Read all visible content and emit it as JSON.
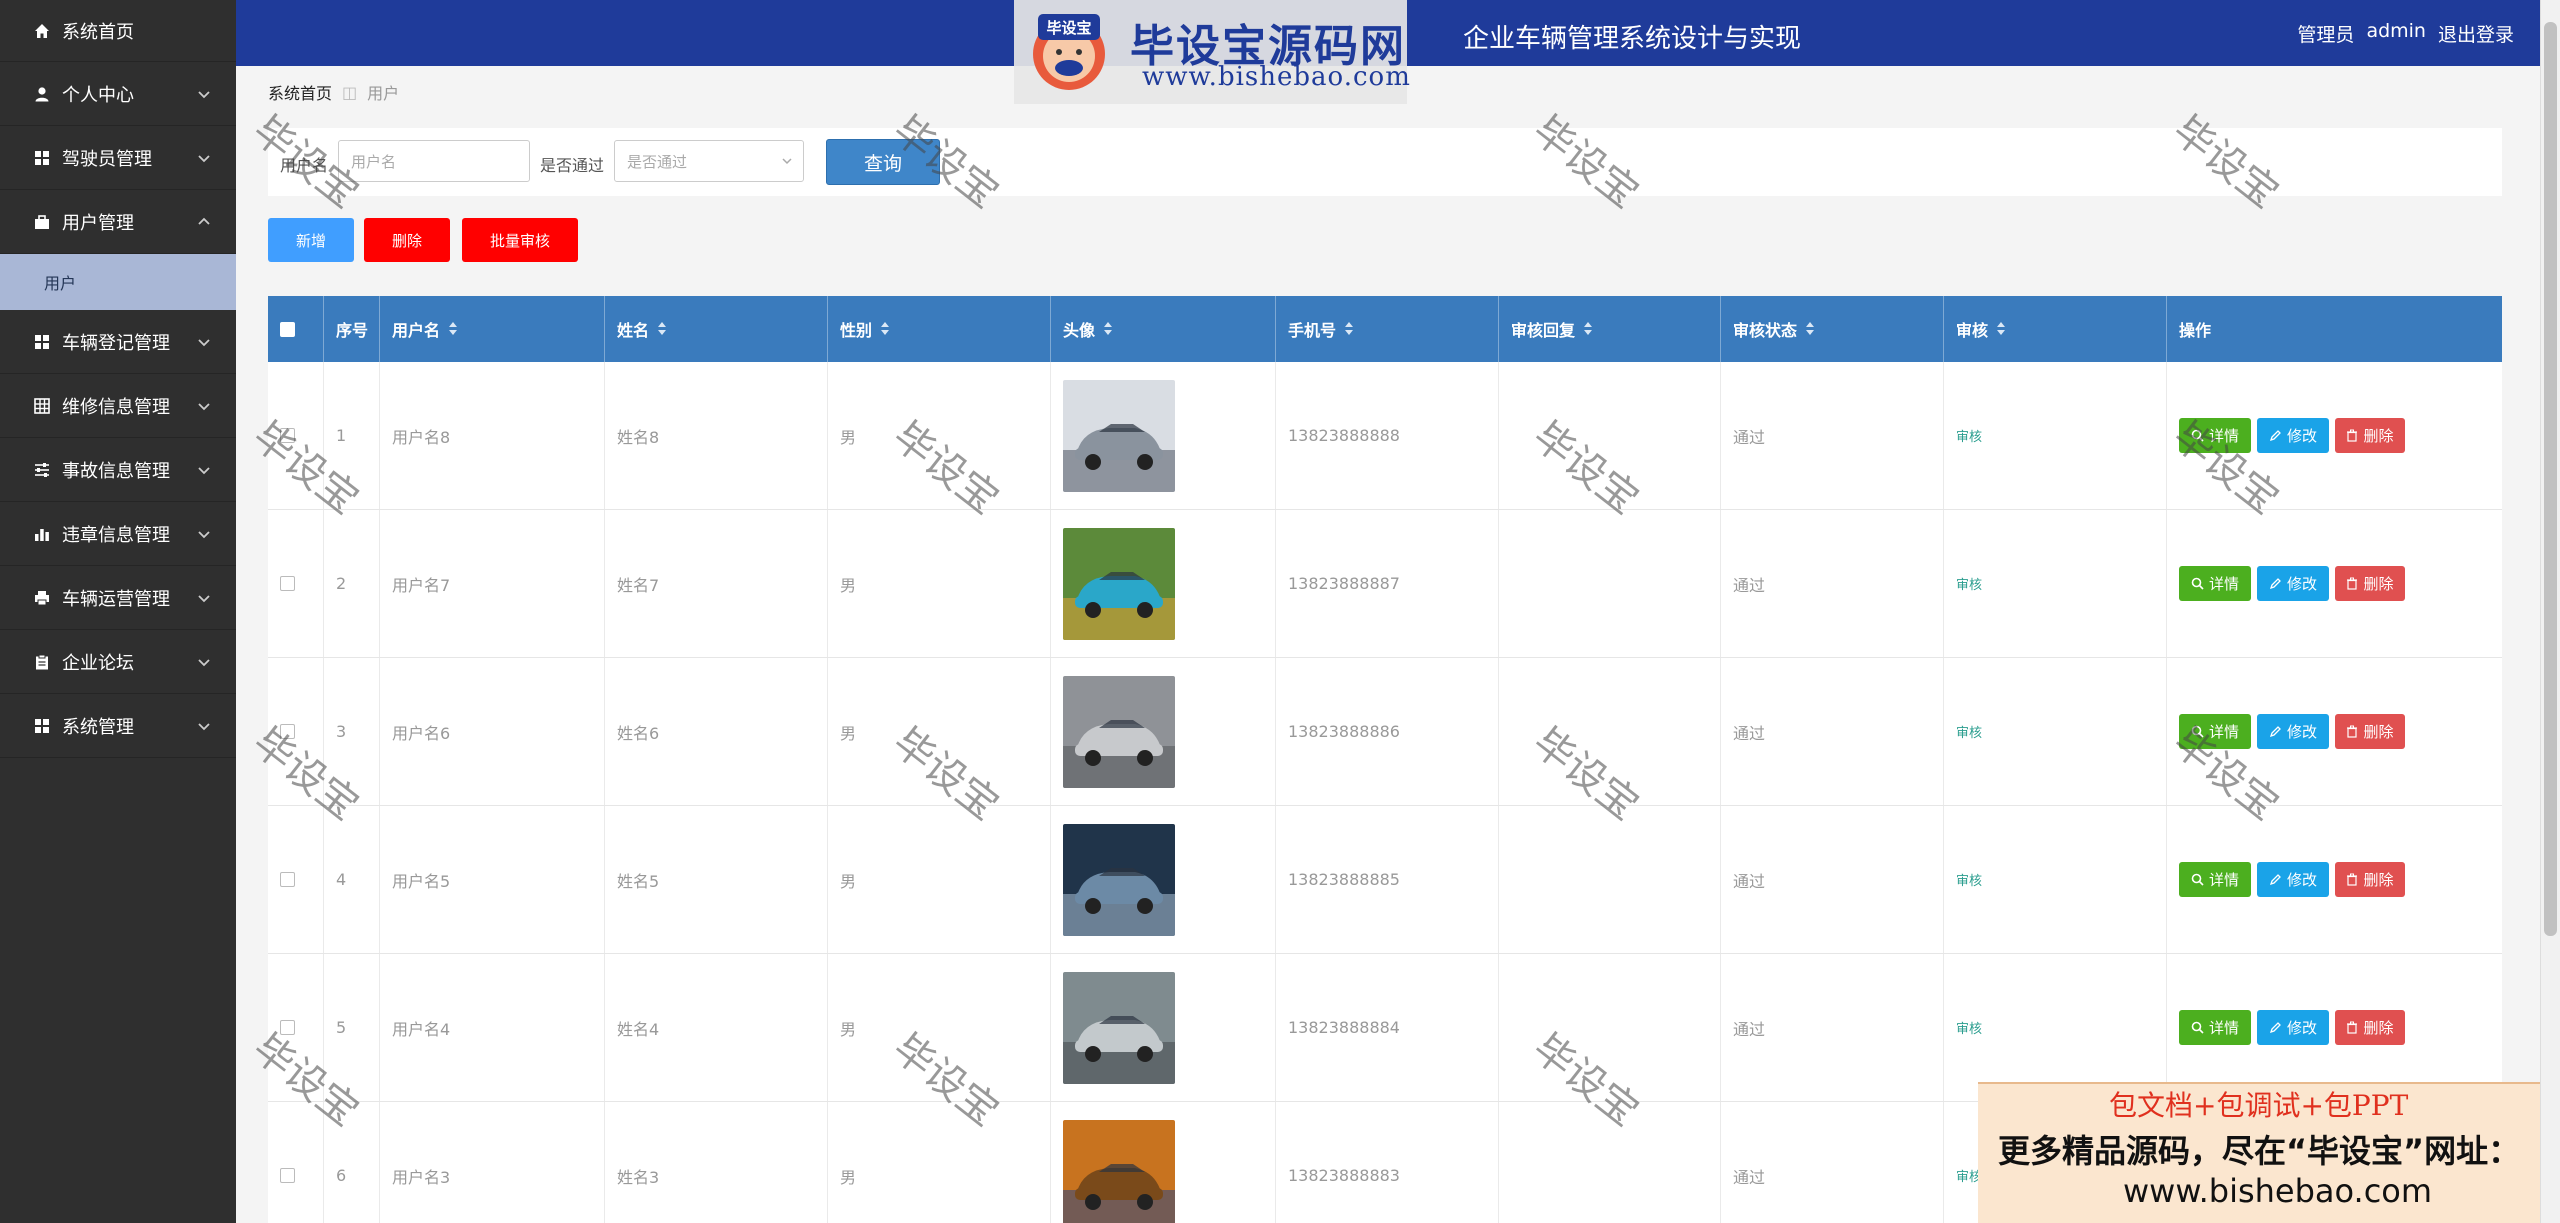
{
  "header": {
    "title": "企业车辆管理系统设计与实现",
    "role": "管理员",
    "username": "admin",
    "logout": "退出登录"
  },
  "brand": {
    "name": "毕设宝源码网",
    "url": "www.bishebao.com"
  },
  "sidebar": {
    "items": [
      {
        "label": "系统首页",
        "icon": "home-icon"
      },
      {
        "label": "个人中心",
        "icon": "user-icon"
      },
      {
        "label": "驾驶员管理",
        "icon": "grid-icon"
      },
      {
        "label": "用户管理",
        "icon": "briefcase-icon"
      },
      {
        "label": "车辆登记管理",
        "icon": "grid-icon"
      },
      {
        "label": "维修信息管理",
        "icon": "table-icon"
      },
      {
        "label": "事故信息管理",
        "icon": "sliders-icon"
      },
      {
        "label": "违章信息管理",
        "icon": "bar-chart-icon"
      },
      {
        "label": "车辆运营管理",
        "icon": "printer-icon"
      },
      {
        "label": "企业论坛",
        "icon": "clipboard-icon"
      },
      {
        "label": "系统管理",
        "icon": "grid-icon"
      }
    ],
    "sub_item": "用户"
  },
  "breadcrumb": {
    "home": "系统首页",
    "current": "用户"
  },
  "search": {
    "username_label": "用户名",
    "username_placeholder": "用户名",
    "pass_label": "是否通过",
    "pass_placeholder": "是否通过",
    "query_button": "查询"
  },
  "actions": {
    "add": "新增",
    "delete": "删除",
    "batch_review": "批量审核"
  },
  "table": {
    "columns": [
      "序号",
      "用户名",
      "姓名",
      "性别",
      "头像",
      "手机号",
      "审核回复",
      "审核状态",
      "审核",
      "操作"
    ],
    "rows": [
      {
        "no": "1",
        "username": "用户名8",
        "name": "姓名8",
        "gender": "男",
        "phone": "13823888888",
        "reply": "",
        "status": "通过",
        "review": "审核"
      },
      {
        "no": "2",
        "username": "用户名7",
        "name": "姓名7",
        "gender": "男",
        "phone": "13823888887",
        "reply": "",
        "status": "通过",
        "review": "审核"
      },
      {
        "no": "3",
        "username": "用户名6",
        "name": "姓名6",
        "gender": "男",
        "phone": "13823888886",
        "reply": "",
        "status": "通过",
        "review": "审核"
      },
      {
        "no": "4",
        "username": "用户名5",
        "name": "姓名5",
        "gender": "男",
        "phone": "13823888885",
        "reply": "",
        "status": "通过",
        "review": "审核"
      },
      {
        "no": "5",
        "username": "用户名4",
        "name": "姓名4",
        "gender": "男",
        "phone": "13823888884",
        "reply": "",
        "status": "通过",
        "review": "审核"
      },
      {
        "no": "6",
        "username": "用户名3",
        "name": "姓名3",
        "gender": "男",
        "phone": "13823888883",
        "reply": "",
        "status": "通过",
        "review": "审核"
      }
    ],
    "op_labels": {
      "detail": "详情",
      "edit": "修改",
      "delete": "删除"
    }
  },
  "watermark": "毕设宝",
  "promo": {
    "line1": "包文档+包调试+包PPT",
    "line2": "更多精品源码，尽在“毕设宝”网址：",
    "line3": "www.bishebao.com"
  },
  "colors": {
    "sidebar_bg": "#2f2f2f",
    "header_bg": "#1f3b9a",
    "table_head": "#3a7bbd",
    "btn_add": "#409eff",
    "btn_red": "#ff0000",
    "detail": "#4caf1f",
    "edit": "#1aa3e8",
    "delete": "#e05050"
  }
}
